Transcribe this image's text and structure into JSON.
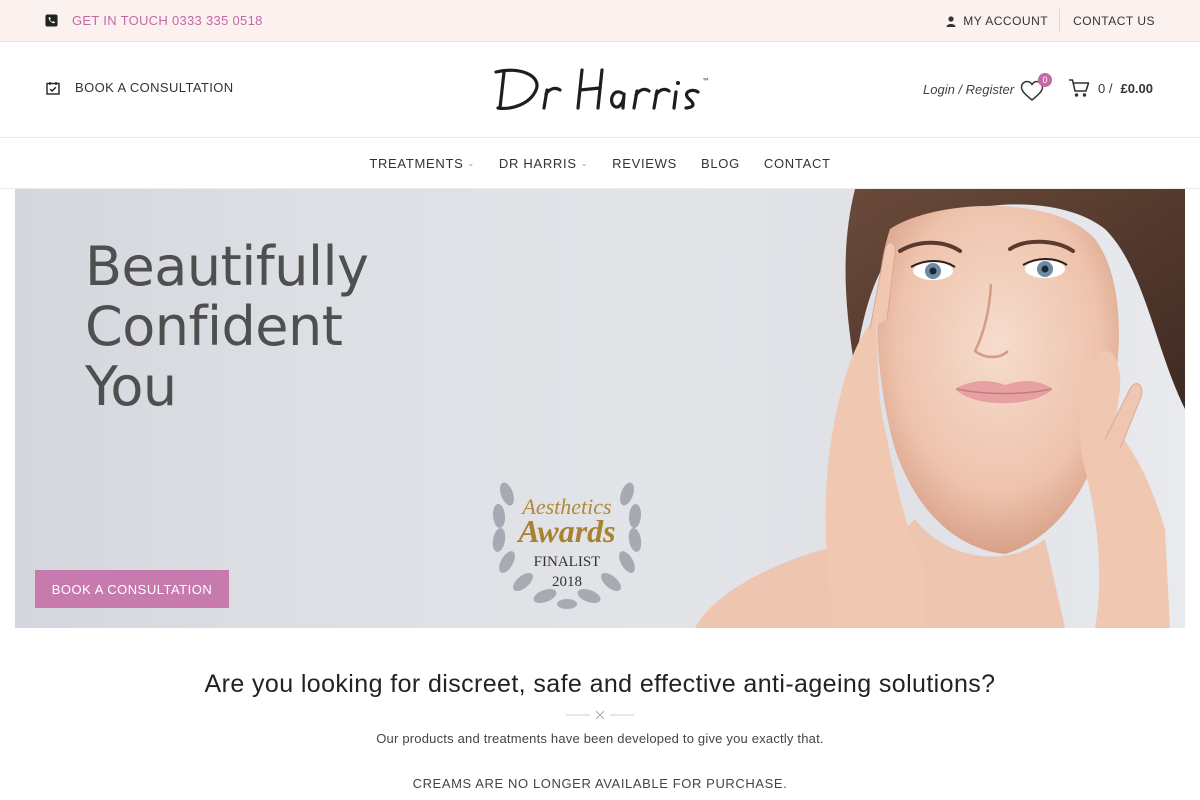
{
  "topbar": {
    "phone_text": "GET IN TOUCH 0333 335 0518",
    "my_account": "MY ACCOUNT",
    "contact_us": "CONTACT US"
  },
  "header": {
    "book_label": "BOOK A CONSULTATION",
    "logo_text": "Dr Harris",
    "logo_tm": "™",
    "login_label": "Login / Register",
    "wishlist_count": "0",
    "cart_count": "0 /",
    "cart_total": "£0.00"
  },
  "nav": {
    "items": [
      {
        "label": "TREATMENTS",
        "has_dropdown": true
      },
      {
        "label": "DR HARRIS",
        "has_dropdown": true
      },
      {
        "label": "REVIEWS",
        "has_dropdown": false
      },
      {
        "label": "BLOG",
        "has_dropdown": false
      },
      {
        "label": "CONTACT",
        "has_dropdown": false
      }
    ]
  },
  "hero": {
    "headline_lines": [
      "Beautifully",
      "Confident",
      "You"
    ],
    "award_line1": "Aesthetics",
    "award_line2": "Awards",
    "award_line3": "FINALIST",
    "award_line4": "2018",
    "cta_label": "BOOK A CONSULTATION"
  },
  "intro": {
    "title": "Are you looking for discreet, safe and effective anti-ageing solutions?",
    "text": "Our products and treatments have been developed to give you exactly that.",
    "note": "CREAMS ARE NO LONGER AVAILABLE FOR PURCHASE."
  },
  "colors": {
    "accent": "#c36aa6",
    "cta": "#c77aae",
    "topbar_bg": "#fbf1ef"
  },
  "icons": [
    "phone-icon",
    "user-icon",
    "calendar-check-icon",
    "heart-icon",
    "cart-icon",
    "chevron-down-icon",
    "laurel-wreath-icon"
  ]
}
